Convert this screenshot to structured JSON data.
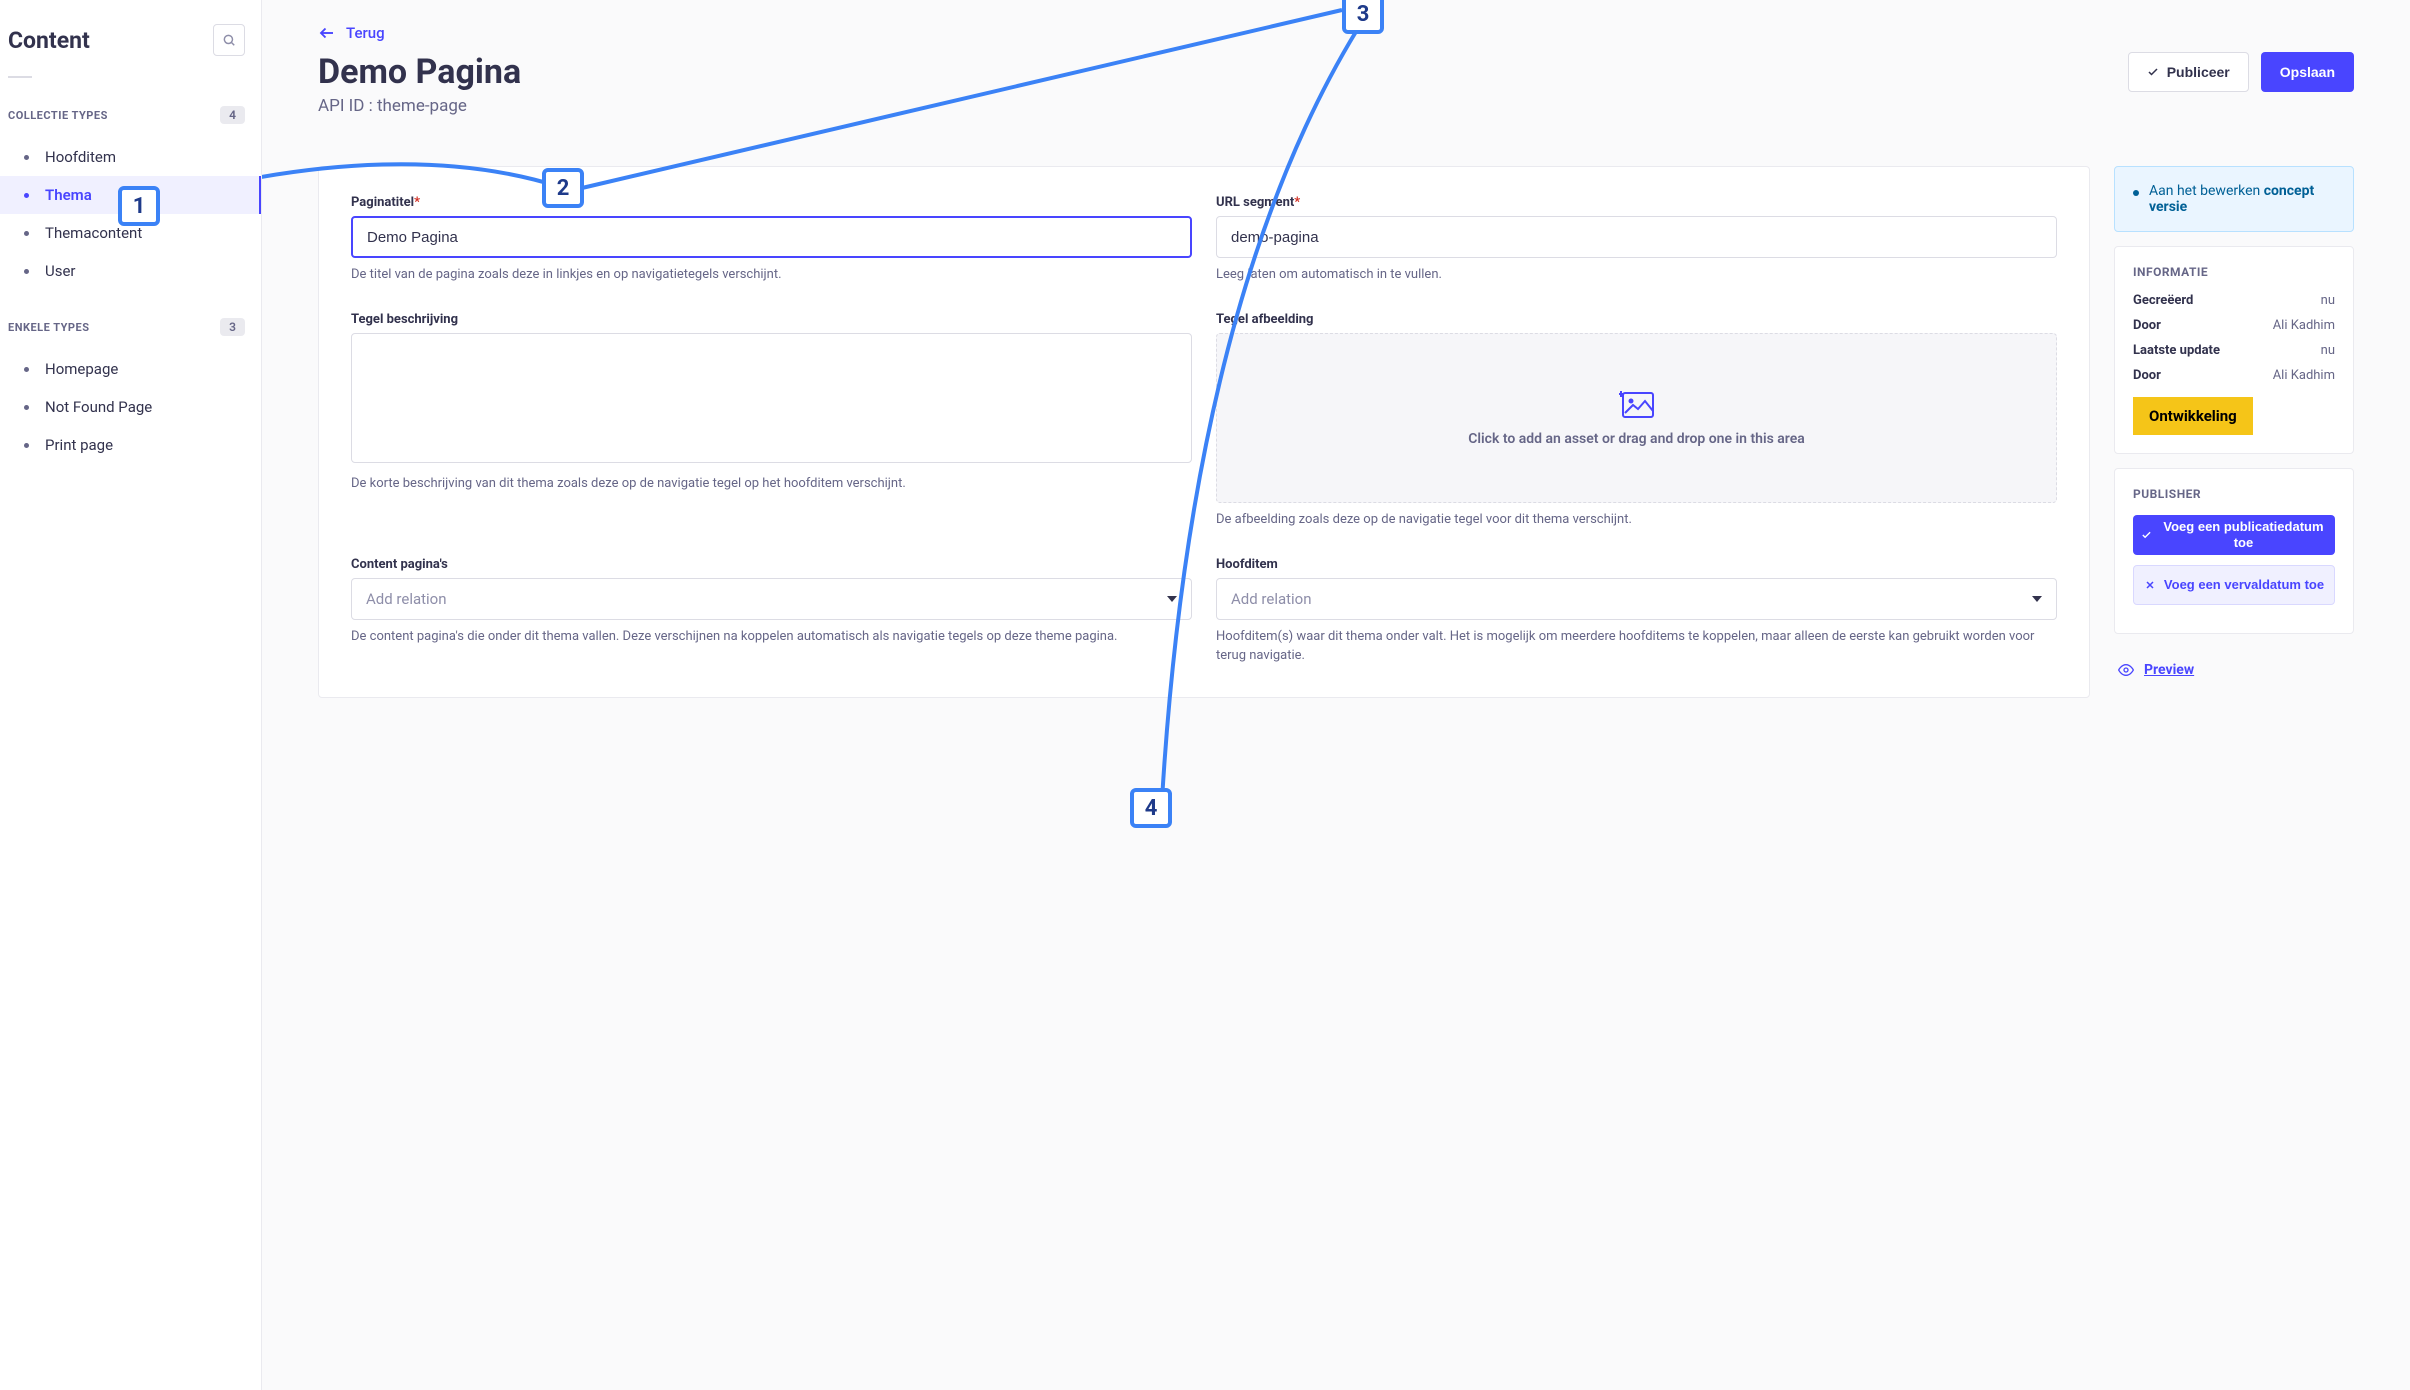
{
  "sidebar": {
    "title": "Content",
    "section1_label": "COLLECTIE TYPES",
    "section1_count": "4",
    "section2_label": "ENKELE TYPES",
    "section2_count": "3",
    "collection_items": [
      "Hoofditem",
      "Thema",
      "Themacontent",
      "User"
    ],
    "single_items": [
      "Homepage",
      "Not Found Page",
      "Print page"
    ],
    "active_index": 1
  },
  "header": {
    "back_label": "Terug",
    "title": "Demo Pagina",
    "api_id_line": "API ID : theme-page",
    "publish_label": "Publiceer",
    "save_label": "Opslaan"
  },
  "form": {
    "page_title": {
      "label": "Paginatitel",
      "value": "Demo Pagina",
      "hint": "De titel van de pagina zoals deze in linkjes en op navigatietegels verschijnt."
    },
    "url_segment": {
      "label": "URL segment",
      "value": "demo-pagina",
      "hint": "Leeg laten om automatisch in te vullen."
    },
    "tile_desc": {
      "label": "Tegel beschrijving",
      "hint": "De korte beschrijving van dit thema zoals deze op de navigatie tegel op het hoofditem verschijnt."
    },
    "tile_image": {
      "label": "Tegel afbeelding",
      "upload_text": "Click to add an asset or drag and drop one in this area",
      "hint": "De afbeelding zoals deze op de navigatie tegel voor dit thema verschijnt."
    },
    "content_pages": {
      "label": "Content pagina's",
      "placeholder": "Add relation",
      "hint": "De content pagina's die onder dit thema vallen. Deze verschijnen na koppelen automatisch als navigatie tegels op deze theme pagina."
    },
    "hoofditem": {
      "label": "Hoofditem",
      "placeholder": "Add relation",
      "hint": "Hoofditem(s) waar dit thema onder valt. Het is mogelijk om meerdere hoofditems te koppelen, maar alleen de eerste kan gebruikt worden voor terug navigatie."
    }
  },
  "aside": {
    "status_prefix": "Aan het bewerken ",
    "status_bold": "concept versie",
    "info_heading": "INFORMATIE",
    "created_label": "Gecreëerd",
    "created_value": "nu",
    "by_label": "Door",
    "by_value": "Ali Kadhim",
    "updated_label": "Laatste update",
    "updated_value": "nu",
    "dev_badge": "Ontwikkeling",
    "publisher_heading": "PUBLISHER",
    "add_pub_date": "Voeg een publicatiedatum toe",
    "add_exp_date": "Voeg een vervaldatum toe",
    "preview_label": "Preview"
  },
  "annotations": {
    "1": "1",
    "2": "2",
    "3": "3",
    "4": "4"
  }
}
